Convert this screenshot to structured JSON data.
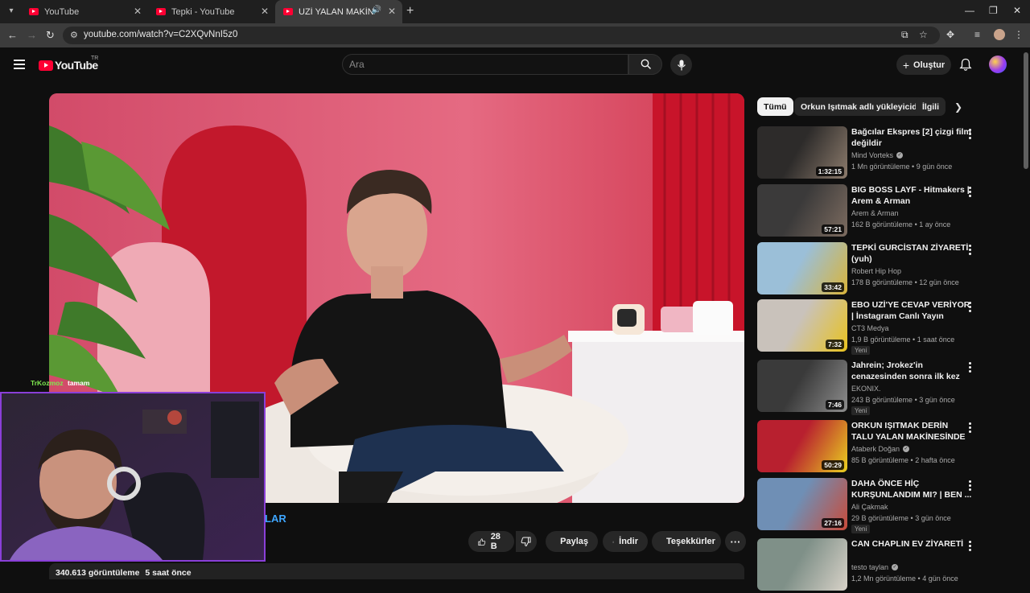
{
  "browser": {
    "tabs": [
      {
        "title": "YouTube"
      },
      {
        "title": "Tepki - YouTube"
      },
      {
        "title": "UZİ YALAN MAKİNESİNDE"
      }
    ],
    "url": "youtube.com/watch?v=C2XQvNnI5z0"
  },
  "header": {
    "logo_text": "YouTube",
    "region": "TR",
    "search_placeholder": "Ara",
    "create_label": "Oluştur"
  },
  "video": {
    "title_fragment": "LAR",
    "likes": "28 B",
    "share_label": "Paylaş",
    "download_label": "İndir",
    "thanks_label": "Teşekkürler",
    "views": "340.613 görüntüleme",
    "posted": "5 saat önce"
  },
  "stream_overlay": {
    "chat_user": "TrKozmoz",
    "chat_message": "tamam"
  },
  "filters": {
    "chips": [
      {
        "label": "Tümü",
        "active": true
      },
      {
        "label": "Orkun Işıtmak adlı yükleyiciden",
        "active": false
      },
      {
        "label": "İlgili",
        "active": false
      }
    ]
  },
  "recommendations": [
    {
      "title": "Bağcılar Ekspres [2] çizgi film değildir",
      "channel": "Mind Vorteks",
      "verified": true,
      "views": "1 Mn görüntüleme",
      "age": "9 gün önce",
      "duration": "1:32:15",
      "badge": "",
      "thumb_colors": [
        "#2d2b2a",
        "#8c7b6c"
      ]
    },
    {
      "title": "BIG BOSS LAYF - Hitmakers | Arem & Arman",
      "channel": "Arem & Arman",
      "verified": false,
      "views": "162 B görüntüleme",
      "age": "1 ay önce",
      "duration": "57:21",
      "badge": "",
      "thumb_colors": [
        "#3b3a3a",
        "#7d6c60"
      ]
    },
    {
      "title": "TEPKİ GURCİSTAN ZİYARETİ (yuh)",
      "channel": "Robert Hip Hop",
      "verified": false,
      "views": "178 B görüntüleme",
      "age": "12 gün önce",
      "duration": "33:42",
      "badge": "",
      "thumb_colors": [
        "#9bbfd8",
        "#d9b43a"
      ]
    },
    {
      "title": "EBO UZİ'YE CEVAP VERİYOR | İnstagram Canlı Yayın",
      "channel": "CT3 Medya",
      "verified": false,
      "views": "1,9 B görüntüleme",
      "age": "1 saat önce",
      "duration": "7:32",
      "badge": "Yeni",
      "thumb_colors": [
        "#c9c2bb",
        "#e8c21e"
      ]
    },
    {
      "title": "Jahrein; Jrokez'in cenazesinden sonra ilk kez konuşuyor. ...",
      "channel": "EKONIX.",
      "verified": false,
      "views": "243 B görüntüleme",
      "age": "3 gün önce",
      "duration": "7:46",
      "badge": "Yeni",
      "thumb_colors": [
        "#3a3a3a",
        "#8d8d8d"
      ]
    },
    {
      "title": "ORKUN IŞITMAK DERİN TALU YALAN MAKİNESİNDE ...",
      "channel": "Ataberk Doğan",
      "verified": true,
      "views": "85 B görüntüleme",
      "age": "2 hafta önce",
      "duration": "50:29",
      "badge": "",
      "thumb_colors": [
        "#b8202f",
        "#e9d020"
      ]
    },
    {
      "title": "DAHA ÖNCE HİÇ KURŞUNLANDIM MI? | BEN ...",
      "channel": "Ali Çakmak",
      "verified": false,
      "views": "29 B görüntüleme",
      "age": "3 gün önce",
      "duration": "27:16",
      "badge": "Yeni",
      "thumb_colors": [
        "#6f8fb5",
        "#c94b3a"
      ]
    },
    {
      "title": "CAN CHAPLIN EV ZİYARETİ",
      "channel": "testo taylan",
      "verified": true,
      "views": "1,2 Mn görüntüleme",
      "age": "4 gün önce",
      "duration": "",
      "badge": "",
      "thumb_colors": [
        "#7f9088",
        "#d8d2c8"
      ]
    }
  ]
}
